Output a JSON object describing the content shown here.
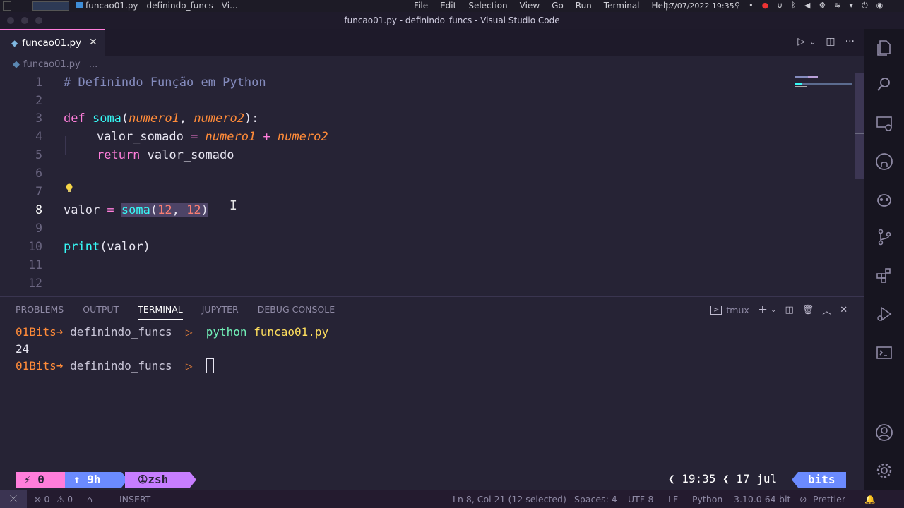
{
  "os": {
    "task_title": "funcao01.py - definindo_funcs - Vi...",
    "menu": [
      "File",
      "Edit",
      "Selection",
      "View",
      "Go",
      "Run",
      "Terminal",
      "Help"
    ],
    "datetime": "17/07/2022 19:35"
  },
  "window": {
    "title": "funcao01.py - definindo_funcs - Visual Studio Code"
  },
  "tab": {
    "label": "funcao01.py",
    "close": "✕"
  },
  "breadcrumb": {
    "file": "funcao01.py",
    "rest": "..."
  },
  "editor": {
    "line_numbers": [
      "1",
      "2",
      "3",
      "4",
      "5",
      "6",
      "7",
      "8",
      "9",
      "10",
      "11",
      "12"
    ],
    "active_line": 8,
    "lines": {
      "l1": "# Definindo Função em Python",
      "l3_def": "def",
      "l3_name": "soma",
      "l3_open": "(",
      "l3_p1": "numero1",
      "l3_comma": ", ",
      "l3_p2": "numero2",
      "l3_close": "):",
      "l4_var": "valor_somado",
      "l4_eq": " = ",
      "l4_a": "numero1",
      "l4_plus": " + ",
      "l4_b": "numero2",
      "l5_ret": "return",
      "l5_val": " valor_somado",
      "l8_var": "valor",
      "l8_eq": " = ",
      "l8_fn": "soma",
      "l8_open": "(",
      "l8_a": "12",
      "l8_comma": ", ",
      "l8_b": "12",
      "l8_close": ")",
      "l10_fn": "print",
      "l10_args": "(valor)"
    }
  },
  "panel": {
    "tabs": [
      "PROBLEMS",
      "OUTPUT",
      "TERMINAL",
      "JUPYTER",
      "DEBUG CONSOLE"
    ],
    "active_tab": "TERMINAL",
    "terminal_name": "tmux",
    "terminal": {
      "user": "01Bits",
      "arrow": "➜",
      "dir": "definindo_funcs",
      "prompt": "▷",
      "cmd": "python",
      "arg": "funcao01.py",
      "output": "24"
    }
  },
  "tmux": {
    "lightning": "⚡  0",
    "uptime": "↑ 9h",
    "shell": "①zsh",
    "time": "19:35",
    "date": "17 jul",
    "host": "bits"
  },
  "status": {
    "errors": "⊗ 0",
    "warnings": "⚠ 0",
    "mode": "-- INSERT --",
    "position": "Ln 8, Col 21 (12 selected)",
    "spaces": "Spaces: 4",
    "encoding": "UTF-8",
    "eol": "LF",
    "language": "Python",
    "interpreter": "3.10.0 64-bit",
    "formatter": "Prettier"
  },
  "colors": {
    "accent_pink": "#ff7edb",
    "keyword_yellow": "#fede5d",
    "function_cyan": "#36f9f6",
    "param_orange": "#ff8b39",
    "number_red": "#f97e72",
    "comment": "#848bbd",
    "editor_bg": "#262335"
  }
}
